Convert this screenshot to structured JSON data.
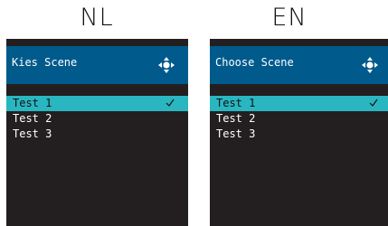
{
  "panels": [
    {
      "language": "NL",
      "header_title": "Kies Scene",
      "items": [
        {
          "label": "Test 1",
          "selected": true
        },
        {
          "label": "Test 2",
          "selected": false
        },
        {
          "label": "Test 3",
          "selected": false
        }
      ]
    },
    {
      "language": "EN",
      "header_title": "Choose Scene",
      "items": [
        {
          "label": "Test 1",
          "selected": true
        },
        {
          "label": "Test 2",
          "selected": false
        },
        {
          "label": "Test 3",
          "selected": false
        }
      ]
    }
  ],
  "icons": {
    "header": "navigation-pad-icon",
    "selected_item": "checkmark-icon"
  },
  "colors": {
    "device_background": "#231f20",
    "header_background": "#005a8c",
    "selection_highlight": "#29b6c0",
    "text": "#ffffff"
  }
}
